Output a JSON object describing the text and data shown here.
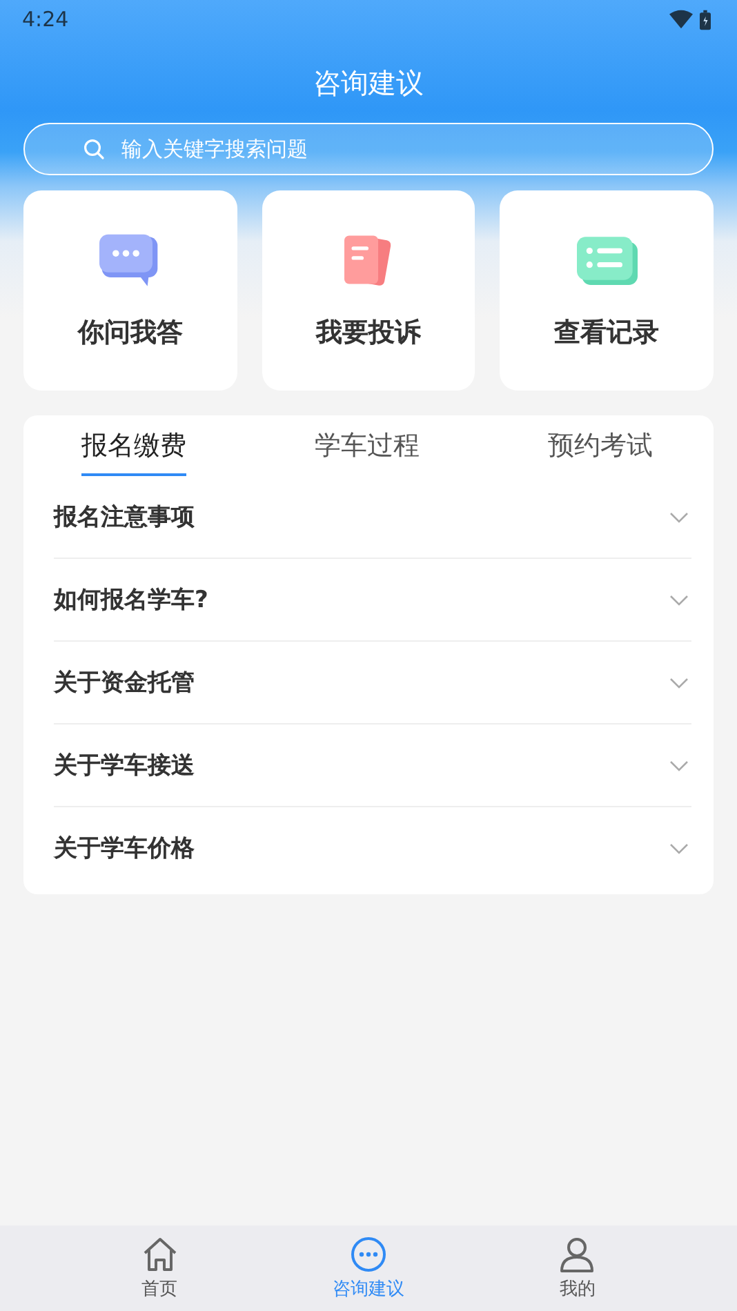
{
  "status_bar": {
    "time": "4:24"
  },
  "header": {
    "title": "咨询建议"
  },
  "search": {
    "placeholder": "输入关键字搜索问题"
  },
  "shortcuts": [
    {
      "kind": "chat",
      "label": "你问我答"
    },
    {
      "kind": "complaint",
      "label": "我要投诉"
    },
    {
      "kind": "records",
      "label": "查看记录"
    }
  ],
  "tabs": [
    {
      "label": "报名缴费",
      "selected": true
    },
    {
      "label": "学车过程",
      "selected": false
    },
    {
      "label": "预约考试",
      "selected": false
    }
  ],
  "questions": [
    {
      "title": "报名注意事项",
      "expanded": false
    },
    {
      "title": "如何报名学车?",
      "expanded": false
    },
    {
      "title": "关于资金托管",
      "expanded": false
    },
    {
      "title": "关于学车接送",
      "expanded": false
    },
    {
      "title": "关于学车价格",
      "expanded": false
    }
  ],
  "bottom_nav": [
    {
      "kind": "home",
      "label": "首页",
      "selected": false
    },
    {
      "kind": "chat",
      "label": "咨询建议",
      "selected": true
    },
    {
      "kind": "user",
      "label": "我的",
      "selected": false
    }
  ]
}
